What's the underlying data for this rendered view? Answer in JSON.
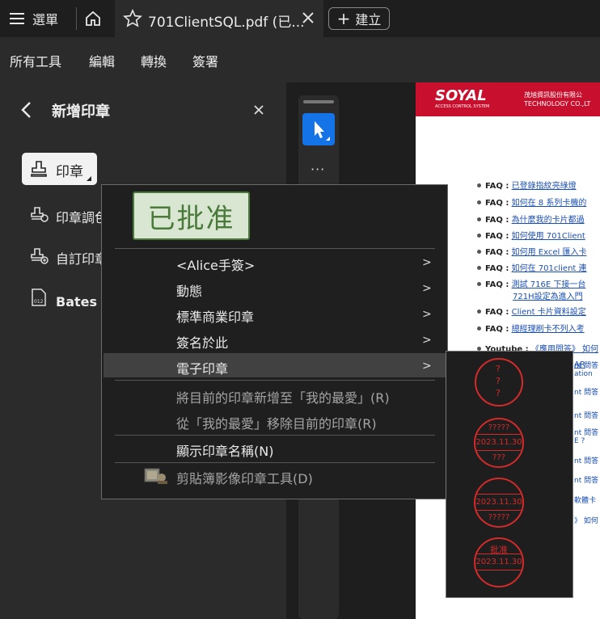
{
  "tabbar": {
    "menu_label": "選單",
    "tab_title": "701ClientSQL.pdf (已...",
    "new_tab_label": "建立"
  },
  "menubar": {
    "items": [
      "所有工具",
      "編輯",
      "轉換",
      "簽署"
    ]
  },
  "panel": {
    "title": "新增印章",
    "stamp_button": "印章",
    "tools": [
      "印章調色",
      "自訂印章",
      "Bates 編號"
    ]
  },
  "stamp_preview": {
    "text": "已批准",
    "color": "#4a7a3a"
  },
  "context_menu": {
    "items": [
      {
        "label": "<Alice手簽>",
        "submenu": true
      },
      {
        "label": "動態",
        "submenu": true
      },
      {
        "label": "標準商業印章",
        "submenu": true
      },
      {
        "label": "簽名於此",
        "submenu": true
      },
      {
        "label": "電子印章",
        "submenu": true,
        "highlighted": true
      },
      {
        "label": "將目前的印章新增至「我的最愛」(R)",
        "disabled": true
      },
      {
        "label": "從「我的最愛」移除目前的印章(R)",
        "disabled": true
      },
      {
        "label": "顯示印章名稱(N)"
      },
      {
        "label": "剪貼簿影像印章工具(D)",
        "disabled": true
      }
    ]
  },
  "submenu_stamps": [
    {
      "lines": [
        "?",
        "?",
        "?"
      ]
    },
    {
      "top": "?????",
      "middle": "2023.11.30",
      "bottom": "???"
    },
    {
      "top": "",
      "middle": "2023.11.30",
      "bottom": "?????"
    },
    {
      "top": "批准",
      "middle": "2023.11.30",
      "bottom": ""
    }
  ],
  "document": {
    "logo": "SOYAL",
    "logo_sub": "ACCESS CONTROL SYSTEM",
    "company_line1": "茂旭資訊股份有限公",
    "company_line2": "TECHNOLOGY CO.,LT",
    "faq_label": "FAQ :",
    "faq_items": [
      "已登錄指紋亮綠燈",
      "如何在 8 系列卡機的",
      "為什麼我的卡片都過",
      "如何使用 701Client",
      "如何用 Excel 匯入卡",
      "如何在 701client 連",
      "測試 716E 下接一台",
      "721H設定為進入門",
      "Client 卡片資料設定",
      "總經理刷卡不列入考"
    ],
    "youtube_label": "Youtube :",
    "youtube_link": "《應用問答》 如何",
    "side_fragments": [
      "AR",
      "nt 問答",
      "ation",
      "nt 問答",
      "nt 問答",
      "nt 問答",
      "E ?",
      "nt 問答",
      "nt 問答",
      "軟體卡",
      "》 如何"
    ]
  },
  "colors": {
    "accent_blue": "#1473e6",
    "stamp_red": "#d42a2a",
    "soyal_red": "#c8102e"
  }
}
